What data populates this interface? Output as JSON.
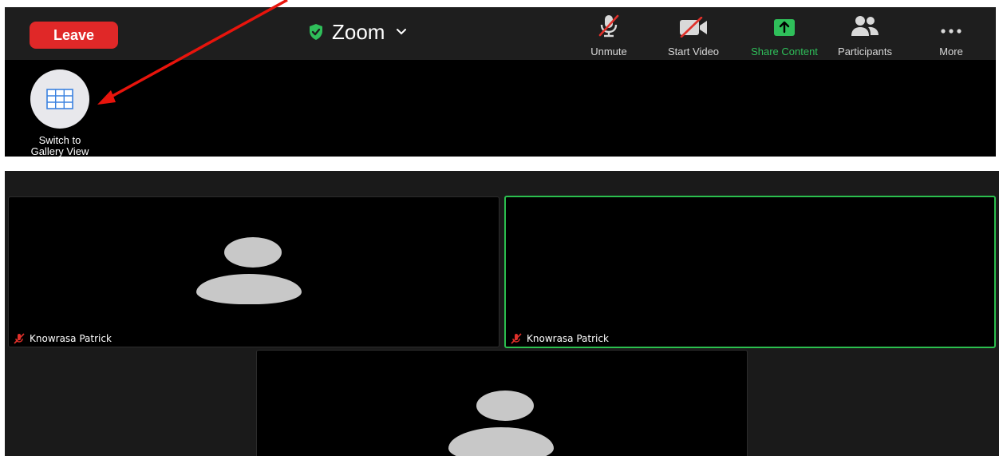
{
  "toolbar": {
    "leave_label": "Leave",
    "meeting_title": "Zoom",
    "tools": [
      {
        "label": "Unmute",
        "icon": "microphone-muted-icon"
      },
      {
        "label": "Start Video",
        "icon": "video-off-icon"
      },
      {
        "label": "Share Content",
        "icon": "share-content-icon"
      },
      {
        "label": "Participants",
        "icon": "participants-icon"
      },
      {
        "label": "More",
        "icon": "more-dots-icon"
      }
    ]
  },
  "gallery_switch": {
    "line1": "Switch to",
    "line2": "Gallery View",
    "icon": "grid-icon"
  },
  "participants": [
    {
      "name": "Knowrasa Patrick",
      "muted": true,
      "active_speaker": false
    },
    {
      "name": "Knowrasa Patrick",
      "muted": true,
      "active_speaker": true
    },
    {
      "name": "",
      "muted": false,
      "active_speaker": false
    }
  ],
  "colors": {
    "leave": "#e02828",
    "share_accent": "#2fbf5a",
    "active_border": "#2bbf4e",
    "annotation_arrow": "#e8140c",
    "muted_red": "#e0302a"
  }
}
